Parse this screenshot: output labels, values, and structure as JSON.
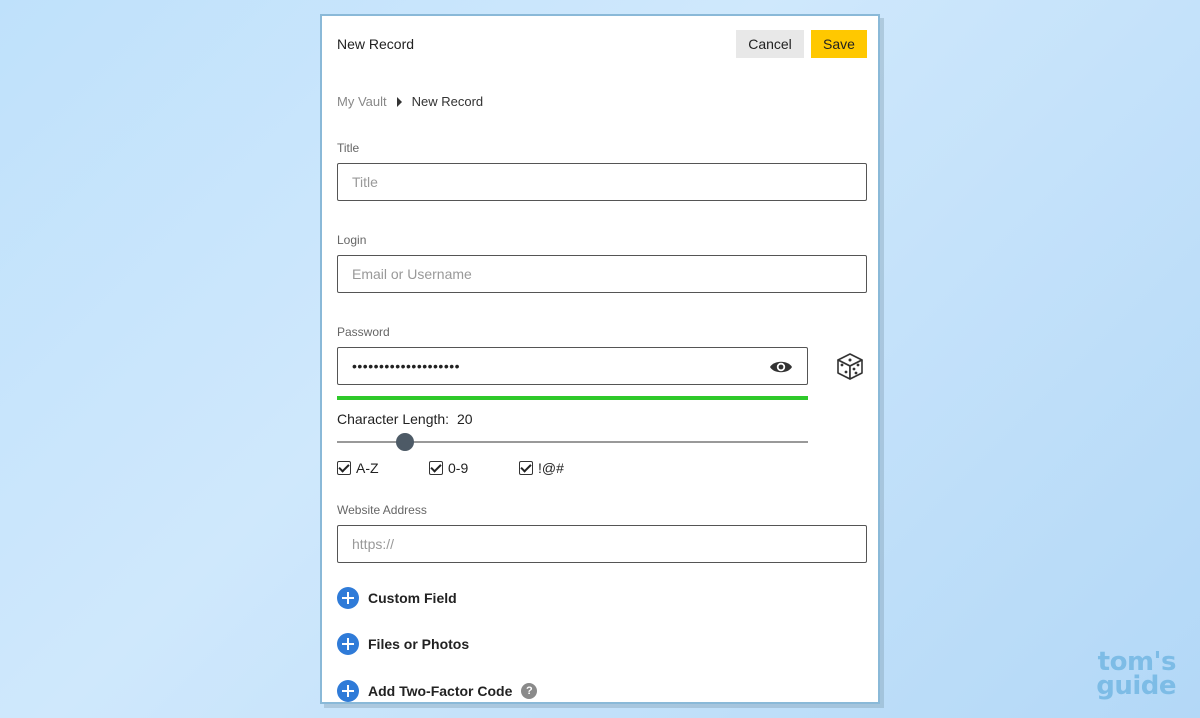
{
  "dialog": {
    "title": "New Record",
    "cancel_label": "Cancel",
    "save_label": "Save"
  },
  "breadcrumb": {
    "root": "My Vault",
    "current": "New Record"
  },
  "fields": {
    "title": {
      "label": "Title",
      "placeholder": "Title"
    },
    "login": {
      "label": "Login",
      "placeholder": "Email or Username"
    },
    "password": {
      "label": "Password",
      "value": "••••••••••••••••••••",
      "strength_fraction": 1.0,
      "strength_color": "#2ec92a"
    },
    "website": {
      "label": "Website Address",
      "placeholder": "https://"
    }
  },
  "generator": {
    "length_label": "Character Length:",
    "length_value": "20",
    "slider_fraction": 0.145,
    "options": [
      "A-Z",
      "0-9",
      "!@#"
    ]
  },
  "actions": {
    "custom_field": "Custom Field",
    "files_photos": "Files or Photos",
    "two_factor": "Add Two-Factor Code",
    "help_glyph": "?"
  },
  "icons": {
    "reveal": "eye-icon",
    "generate": "dice-icon",
    "add": "plus-circle-icon",
    "help": "question-circle-icon"
  },
  "colors": {
    "save_button": "#ffc800",
    "add_icon": "#2f7bd8"
  },
  "watermark": {
    "line1": "tom's",
    "line2": "guide"
  }
}
